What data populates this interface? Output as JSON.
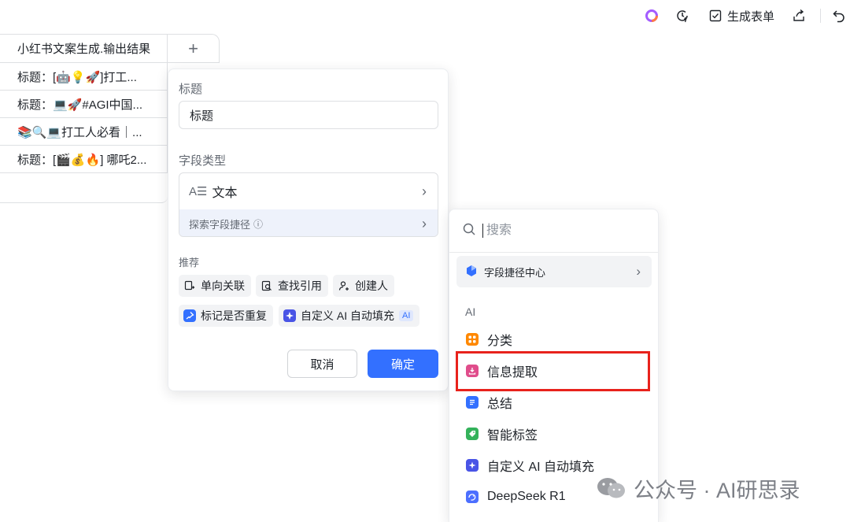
{
  "toolbar": {
    "generate_form_label": "生成表单"
  },
  "table": {
    "column_header": "小红书文案生成.输出结果",
    "add_column_symbol": "+",
    "rows": [
      "标题：[🤖💡🚀]打工...",
      "标题：💻🚀#AGI中国...",
      "📚🔍💻打工人必看｜...",
      "标题：[🎬💰🔥] 哪吒2..."
    ]
  },
  "field_panel": {
    "title_label": "标题",
    "title_value": "标题",
    "type_label": "字段类型",
    "type_icon_text": "A☰",
    "type_value": "文本",
    "explore_label": "探索字段捷径",
    "info_symbol": "ⓘ",
    "recommend_label": "推荐",
    "chips": [
      "单向关联",
      "查找引用",
      "创建人",
      "标记是否重复",
      "自定义 AI 自动填充"
    ],
    "ai_badge": "AI",
    "cancel_label": "取消",
    "confirm_label": "确定"
  },
  "dropdown": {
    "search_placeholder": "搜索",
    "hub_label": "字段捷径中心",
    "section_label": "AI",
    "options": [
      {
        "label": "分类",
        "color": "#ff8800"
      },
      {
        "label": "信息提取",
        "color": "#e04d8b"
      },
      {
        "label": "总结",
        "color": "#3370ff"
      },
      {
        "label": "智能标签",
        "color": "#34b25b"
      },
      {
        "label": "自定义 AI 自动填充",
        "color": "#4954e6"
      },
      {
        "label": "DeepSeek R1",
        "color": "#4c6fff"
      }
    ]
  },
  "watermark": {
    "text": "公众号 · AI研思录"
  },
  "colors": {
    "primary": "#3370ff",
    "highlight_border": "#e8221c"
  }
}
